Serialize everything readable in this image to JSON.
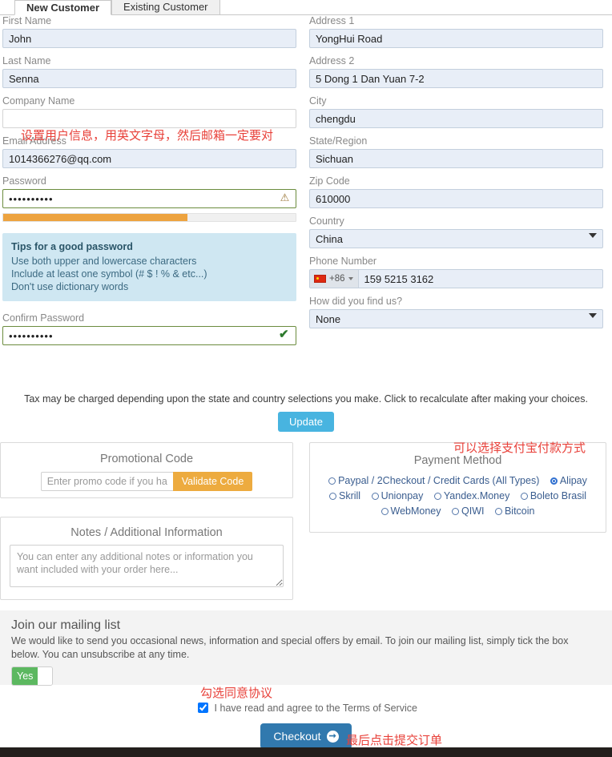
{
  "tabs": [
    {
      "label": "New Customer",
      "active": true
    },
    {
      "label": "Existing Customer",
      "active": false
    }
  ],
  "left_column": {
    "first_name": {
      "label": "First Name",
      "value": "John"
    },
    "last_name": {
      "label": "Last Name",
      "value": "Senna"
    },
    "company_name": {
      "label": "Company Name",
      "value": ""
    },
    "email": {
      "label": "Email Address",
      "value": "1014366276@qq.com"
    },
    "password": {
      "label": "Password",
      "value": "••••••••••",
      "icon": "warning-triangle-icon"
    },
    "password_strength_percent": 63,
    "tips": {
      "title": "Tips for a good password",
      "lines": [
        "Use both upper and lowercase characters",
        "Include at least one symbol (# $ ! % & etc...)",
        "Don't use dictionary words"
      ]
    },
    "confirm_password": {
      "label": "Confirm Password",
      "value": "••••••••••",
      "icon": "check-mark-icon"
    }
  },
  "right_column": {
    "address1": {
      "label": "Address 1",
      "value": "YongHui Road"
    },
    "address2": {
      "label": "Address 2",
      "value": "5 Dong 1 Dan Yuan 7-2"
    },
    "city": {
      "label": "City",
      "value": "chengdu"
    },
    "state": {
      "label": "State/Region",
      "value": "Sichuan"
    },
    "zip": {
      "label": "Zip Code",
      "value": "610000"
    },
    "country": {
      "label": "Country",
      "value": "China"
    },
    "phone": {
      "label": "Phone Number",
      "country_code": "+86",
      "flag": "china-flag-icon",
      "value": "159 5215 3162"
    },
    "find_us": {
      "label": "How did you find us?",
      "value": "None"
    }
  },
  "tax": {
    "notice": "Tax may be charged depending upon the state and country selections you make. Click to recalculate after making your choices.",
    "update_label": "Update"
  },
  "promo": {
    "title": "Promotional Code",
    "placeholder": "Enter promo code if you have one",
    "value": "",
    "button_label": "Validate Code"
  },
  "notes": {
    "title": "Notes / Additional Information",
    "placeholder": "You can enter any additional notes or information you want included with your order here...",
    "value": ""
  },
  "payment": {
    "title": "Payment Method",
    "options": [
      {
        "label": "Paypal / 2Checkout / Credit Cards (All Types)",
        "selected": false
      },
      {
        "label": "Alipay",
        "selected": true
      },
      {
        "label": "Skrill",
        "selected": false
      },
      {
        "label": "Unionpay",
        "selected": false
      },
      {
        "label": "Yandex.Money",
        "selected": false
      },
      {
        "label": "Boleto Brasil",
        "selected": false
      },
      {
        "label": "WebMoney",
        "selected": false
      },
      {
        "label": "QIWI",
        "selected": false
      },
      {
        "label": "Bitcoin",
        "selected": false
      }
    ]
  },
  "mailing": {
    "title": "Join our mailing list",
    "body": "We would like to send you occasional news, information and special offers by email. To join our mailing list, simply tick the box below. You can unsubscribe at any time.",
    "toggle_label": "Yes",
    "toggle_on": true
  },
  "terms": {
    "label": "I have read and agree to the Terms of Service",
    "checked": true
  },
  "checkout": {
    "label": "Checkout",
    "arrow": "arrow-right-icon"
  },
  "annotations": {
    "company": "设置用户信息，用英文字母，然后邮箱一定要对",
    "payment": "可以选择支付宝付款方式",
    "terms": "勾选同意协议",
    "checkout": "最后点击提交订单"
  },
  "colors": {
    "accent_blue": "#3179ae",
    "update_blue": "#48b4e0",
    "orange": "#edab3f",
    "green": "#5cb860",
    "annotation_red": "#e8413a",
    "tips_bg": "#cfe7f2",
    "input_bg": "#e8eef7"
  }
}
